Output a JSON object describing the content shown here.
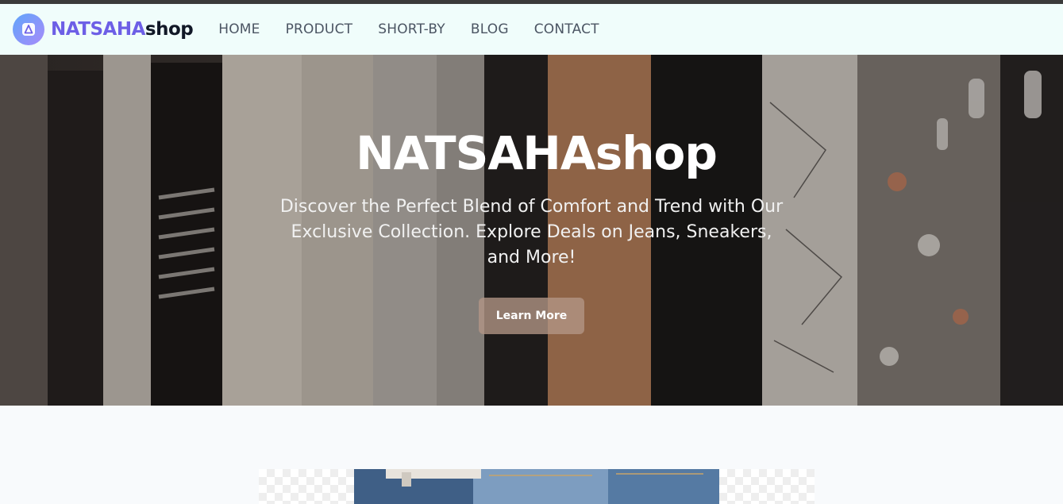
{
  "nav": {
    "brand_primary": "NATSAHA",
    "brand_secondary": "shop",
    "logo_icon": "triangle-logo-icon",
    "links": [
      "HOME",
      "PRODUCT",
      "SHORT-BY",
      "BLOG",
      "CONTACT"
    ]
  },
  "hero": {
    "title": "NATSAHAshop",
    "subtitle": "Discover the Perfect Blend of Comfort and Trend with Our Exclusive Collection. Explore Deals on Jeans, Sneakers, and More!",
    "button_label": "Learn More"
  },
  "colors": {
    "brand_purple": "#6d5fe6",
    "nav_bg": "#f0fdfb",
    "button_bg": "#b49687"
  }
}
